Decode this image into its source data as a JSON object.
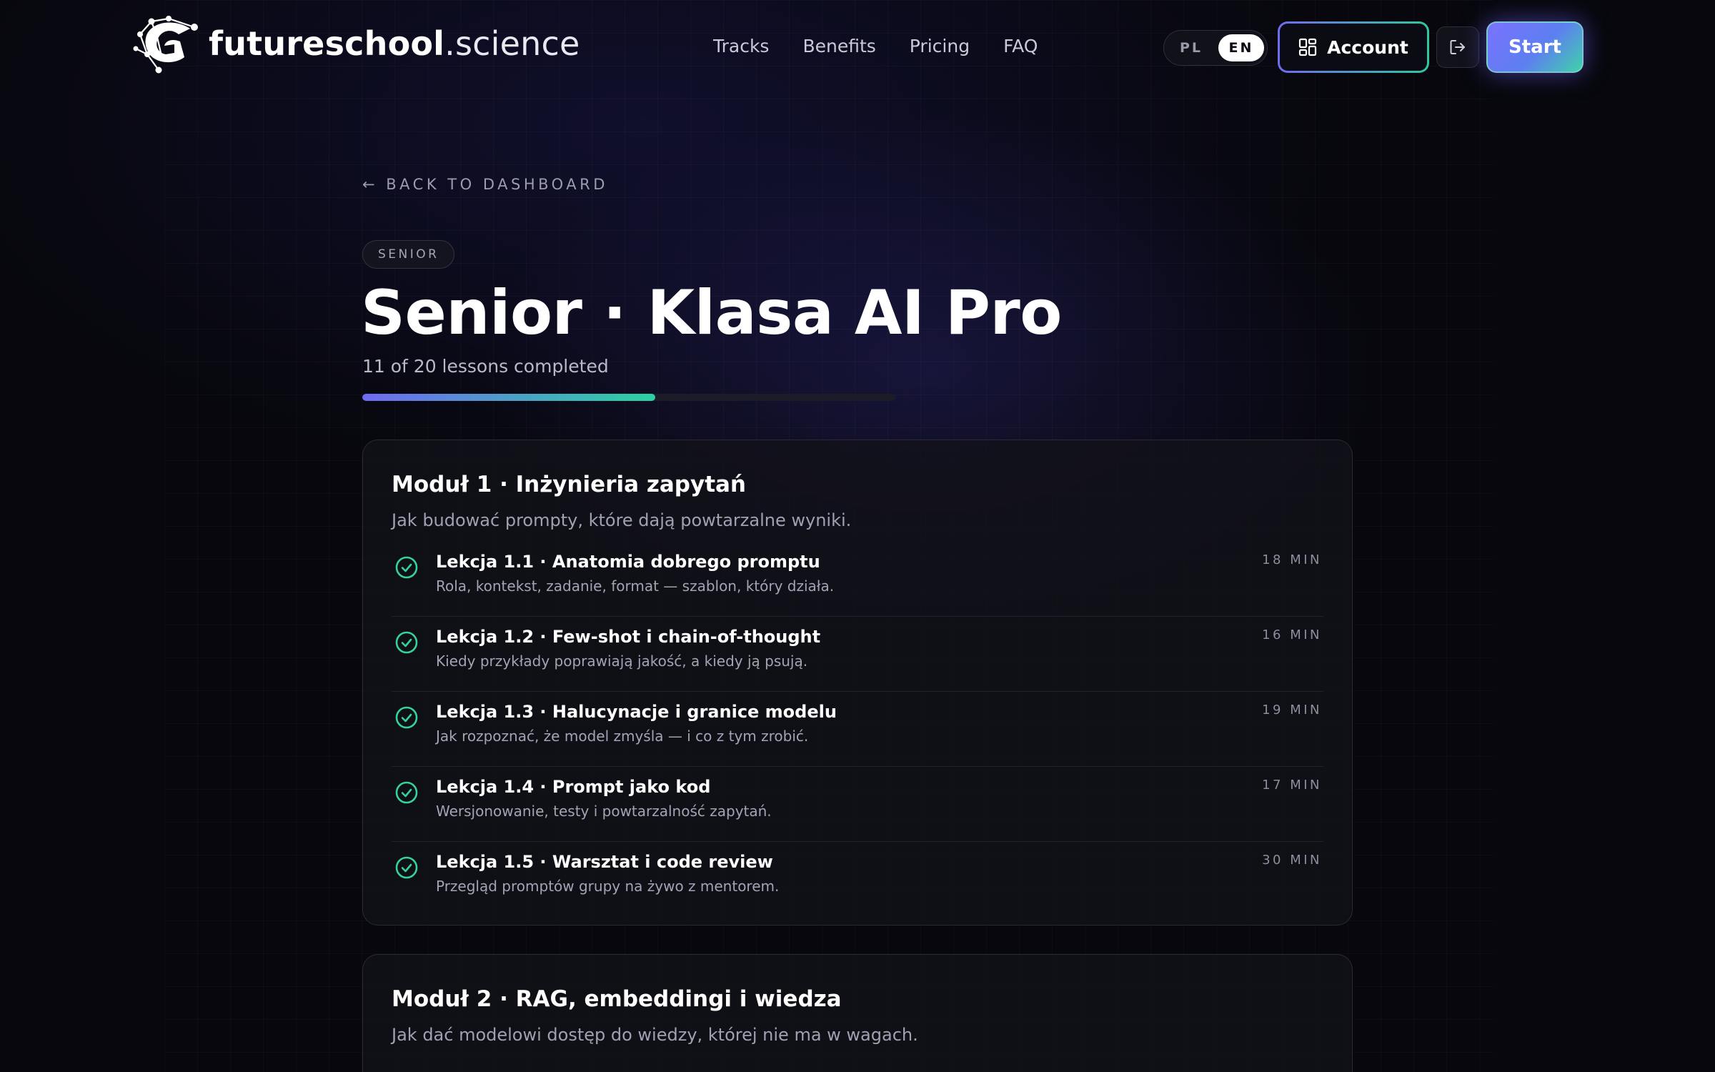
{
  "brand": {
    "name_bold": "futureschool",
    "name_light": ".science"
  },
  "nav": {
    "items": [
      {
        "label": "Tracks"
      },
      {
        "label": "Benefits"
      },
      {
        "label": "Pricing"
      },
      {
        "label": "FAQ"
      }
    ]
  },
  "language": {
    "options": [
      "PL",
      "EN"
    ],
    "selected": "EN"
  },
  "header_actions": {
    "account_label": "Account",
    "start_label": "Start",
    "account_icon": "dashboard-grid-icon",
    "logout_icon": "logout-icon"
  },
  "back_link": {
    "label": "← BACK TO DASHBOARD"
  },
  "course": {
    "badge": "SENIOR",
    "title": "Senior · Klasa AI Pro",
    "progress_text": "11 of 20 lessons completed",
    "completed": 11,
    "total": 20
  },
  "colors": {
    "accent_start": "#6f6af2",
    "accent_end": "#2bd1a1",
    "check": "#34d399"
  },
  "modules": [
    {
      "title": "Moduł 1 · Inżynieria zapytań",
      "description": "Jak budować prompty, które dają powtarzalne wyniki.",
      "lessons": [
        {
          "title": "Lekcja 1.1 · Anatomia dobrego promptu",
          "description": "Rola, kontekst, zadanie, format — szablon, który działa.",
          "duration": "18 MIN",
          "completed": true
        },
        {
          "title": "Lekcja 1.2 · Few-shot i chain-of-thought",
          "description": "Kiedy przykłady poprawiają jakość, a kiedy ją psują.",
          "duration": "16 MIN",
          "completed": true
        },
        {
          "title": "Lekcja 1.3 · Halucynacje i granice modelu",
          "description": "Jak rozpoznać, że model zmyśla — i co z tym zrobić.",
          "duration": "19 MIN",
          "completed": true
        },
        {
          "title": "Lekcja 1.4 · Prompt jako kod",
          "description": "Wersjonowanie, testy i powtarzalność zapytań.",
          "duration": "17 MIN",
          "completed": true
        },
        {
          "title": "Lekcja 1.5 · Warsztat i code review",
          "description": "Przegląd promptów grupy na żywo z mentorem.",
          "duration": "30 MIN",
          "completed": true
        }
      ]
    },
    {
      "title": "Moduł 2 · RAG, embeddingi i wiedza",
      "description": "Jak dać modelowi dostęp do wiedzy, której nie ma w wagach.",
      "lessons": []
    }
  ]
}
